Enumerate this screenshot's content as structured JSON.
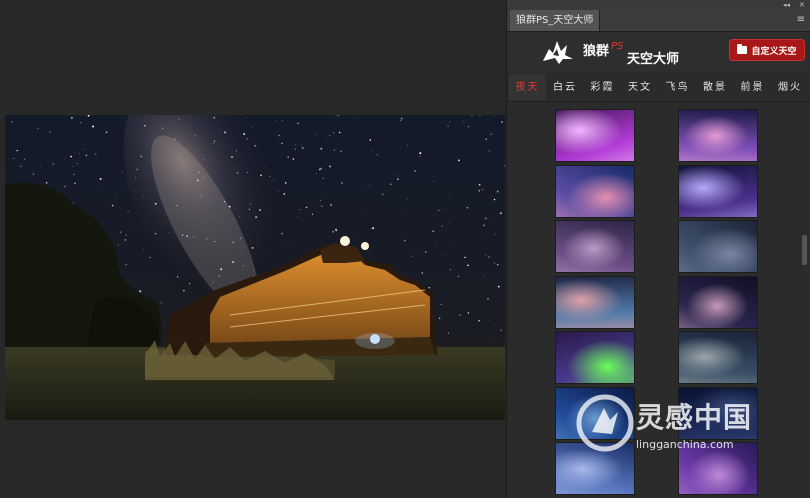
{
  "panel": {
    "tab_label": "狼群PS_天空大师",
    "topbar_collapse": "◂◂",
    "topbar_close": "✕",
    "menu_glyph": "≡"
  },
  "header": {
    "logo_title": "狼群",
    "logo_ps": "PS",
    "logo_subtitle": "天空大师",
    "custom_sky_button": "自定义天空",
    "accent_color": "#e53b2f",
    "button_color": "#a81818"
  },
  "category_tabs": [
    {
      "label": "夜天",
      "active": true
    },
    {
      "label": "白云",
      "active": false
    },
    {
      "label": "彩霞",
      "active": false
    },
    {
      "label": "天文",
      "active": false
    },
    {
      "label": "飞鸟",
      "active": false
    },
    {
      "label": "散景",
      "active": false
    },
    {
      "label": "前景",
      "active": false
    },
    {
      "label": "烟火",
      "active": false
    }
  ],
  "thumbnails": [
    {
      "name": "aurora-purple",
      "colors": [
        "#3a1550",
        "#b13ad6",
        "#f3b8ff"
      ]
    },
    {
      "name": "milkyway-violet",
      "colors": [
        "#1d1a44",
        "#7c4fb8",
        "#e69ad4"
      ]
    },
    {
      "name": "night-clouds-blue",
      "colors": [
        "#1a2a6a",
        "#5b4ea6",
        "#e58fb0"
      ]
    },
    {
      "name": "lightning-clouds",
      "colors": [
        "#10143a",
        "#4b2f8a",
        "#b8a8ff"
      ]
    },
    {
      "name": "lightning-purple",
      "colors": [
        "#2e2446",
        "#6a4e86",
        "#b99ac6"
      ]
    },
    {
      "name": "lightning-dusk",
      "colors": [
        "#1b2438",
        "#3f4f6a",
        "#7a86a2"
      ]
    },
    {
      "name": "aurora-dusk",
      "colors": [
        "#20284a",
        "#4f7aa8",
        "#e0a0a8"
      ]
    },
    {
      "name": "milkyway-dark",
      "colors": [
        "#120f24",
        "#2b2650",
        "#c79ab6"
      ]
    },
    {
      "name": "aurora-green",
      "colors": [
        "#2a1a4a",
        "#4a3a90",
        "#6bff5a"
      ]
    },
    {
      "name": "milkyway-arch",
      "colors": [
        "#1a2338",
        "#3a4e66",
        "#9aa6aa"
      ]
    },
    {
      "name": "night-blue",
      "colors": [
        "#0c1a44",
        "#204a98",
        "#6a9ad0"
      ]
    },
    {
      "name": "night-city",
      "colors": [
        "#0a1230",
        "#1c2a5a",
        "#3a4a7a"
      ]
    },
    {
      "name": "starfield-blue",
      "colors": [
        "#1a2e66",
        "#5a78c0",
        "#a8b8e8"
      ]
    },
    {
      "name": "starfield-purple",
      "colors": [
        "#2a1a5a",
        "#6a3aa8",
        "#c08ad8"
      ]
    }
  ],
  "watermark": {
    "title": "灵感中国",
    "url": "lingganchina.com"
  }
}
